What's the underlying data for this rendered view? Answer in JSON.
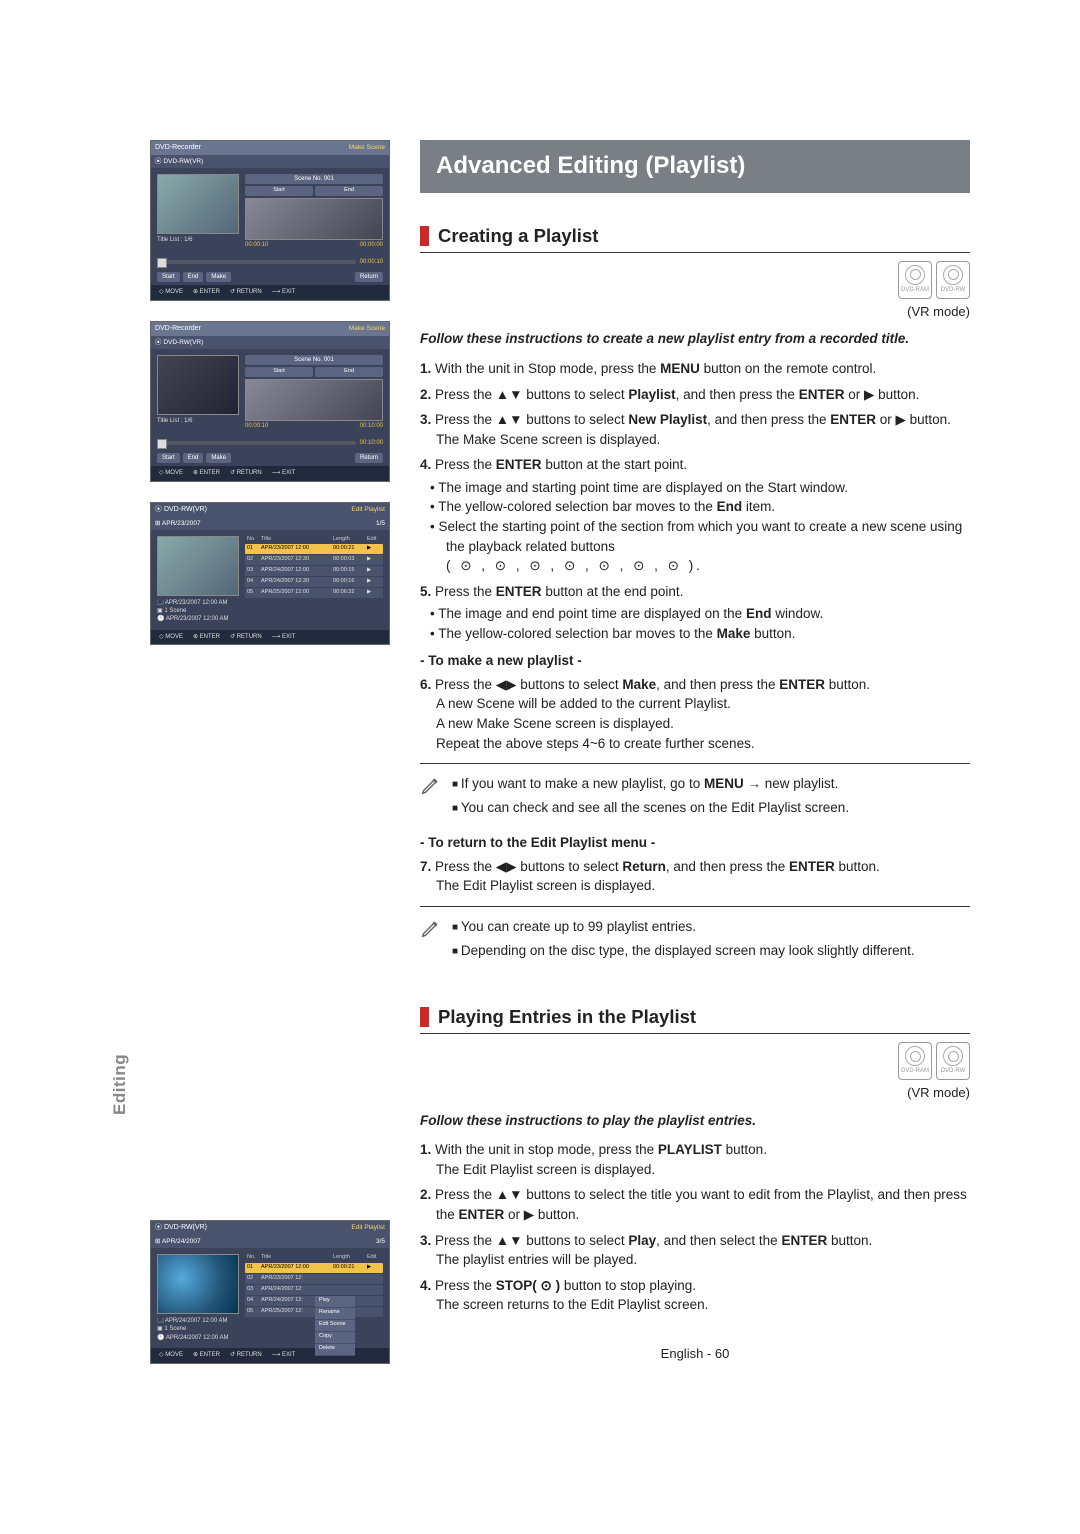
{
  "vlabel": "Editing",
  "banner": "Advanced Editing (Playlist)",
  "pagenum": "English - 60",
  "mini1": {
    "title": "DVD-Recorder",
    "mode": "Make Scene",
    "sub": "DVD-RW(VR)",
    "thumbTitle": "Title List : 1/6",
    "sceneHead": "Scene No. 001",
    "btnStart": "Start",
    "btnEnd": "End",
    "t1": "00:00:10",
    "t2": "00:00:00",
    "ptime": "00:00:10",
    "c1": "Start",
    "c2": "End",
    "c3": "Make",
    "c4": "Return",
    "f1": "MOVE",
    "f2": "ENTER",
    "f3": "RETURN",
    "f4": "EXIT"
  },
  "mini2": {
    "title": "DVD-Recorder",
    "mode": "Make Scene",
    "sub": "DVD-RW(VR)",
    "thumbTitle": "Title List : 1/6",
    "sceneHead": "Scene No. 001",
    "btnStart": "Start",
    "btnEnd": "End",
    "t1": "00:00:10",
    "t2": "00:10:00",
    "ptime": "00:10:00",
    "c1": "Start",
    "c2": "End",
    "c3": "Make",
    "c4": "Return",
    "f1": "MOVE",
    "f2": "ENTER",
    "f3": "RETURN",
    "f4": "EXIT"
  },
  "mini3": {
    "sub": "DVD-RW(VR)",
    "mode": "Edit Playlist",
    "date": "APR/23/2007",
    "pager": "1/5",
    "hNo": "No.",
    "hTitle": "Title",
    "hLen": "Length",
    "hEd": "Edit",
    "rows": [
      {
        "no": "01",
        "title": "APR/23/2007 12:00",
        "len": "00:00:21",
        "ed": "▶"
      },
      {
        "no": "02",
        "title": "APR/23/2007 12:30",
        "len": "00:00:03",
        "ed": "▶"
      },
      {
        "no": "03",
        "title": "APR/24/2007 12:00",
        "len": "00:00:15",
        "ed": "▶"
      },
      {
        "no": "04",
        "title": "APR/24/2007 12:30",
        "len": "00:00:16",
        "ed": "▶"
      },
      {
        "no": "05",
        "title": "APR/25/2007 12:00",
        "len": "00:06:32",
        "ed": "▶"
      }
    ],
    "meta1": "APR/23/2007 12:00 AM",
    "meta2": "1 Scene",
    "meta3": "APR/23/2007 12:00 AM",
    "f1": "MOVE",
    "f2": "ENTER",
    "f3": "RETURN",
    "f4": "EXIT"
  },
  "mini4": {
    "sub": "DVD-RW(VR)",
    "mode": "Edit Playlist",
    "date": "APR/24/2007",
    "pager": "3/5",
    "hNo": "No.",
    "hTitle": "Title",
    "hLen": "Length",
    "hEd": "Edit",
    "rows": [
      {
        "no": "01",
        "title": "APR/23/2007 12:00",
        "len": "00:00:21",
        "ed": "▶"
      },
      {
        "no": "02",
        "title": "APR/23/2007 12:",
        "len": "",
        "ed": ""
      },
      {
        "no": "03",
        "title": "APR/24/2007 12:",
        "len": "",
        "ed": ""
      },
      {
        "no": "04",
        "title": "APR/24/2007 12:",
        "len": "",
        "ed": ""
      },
      {
        "no": "05",
        "title": "APR/25/2007 12:",
        "len": "",
        "ed": ""
      }
    ],
    "ctx": [
      "Play",
      "Rename",
      "Edit Scene",
      "Copy",
      "Delete"
    ],
    "meta1": "APR/24/2007 12:00 AM",
    "meta2": "1 Scene",
    "meta3": "APR/24/2007 12:00 AM",
    "f1": "MOVE",
    "f2": "ENTER",
    "f3": "RETURN",
    "f4": "EXIT"
  },
  "sec1": {
    "h": "Creating a Playlist",
    "discs": [
      "DVD-RAM",
      "DVD-RW"
    ],
    "vrmode": "(VR mode)",
    "lead": "Follow these instructions to create a new playlist entry from a recorded title.",
    "s1a": "1.",
    "s1b": " With the unit in Stop mode, press the ",
    "s1c": "MENU",
    "s1d": " button on the remote control.",
    "s2a": "2.",
    "s2b": " Press the ▲▼ buttons to select ",
    "s2c": "Playlist",
    "s2d": ", and then press the ",
    "s2e": "ENTER",
    "s2f": " or ▶ button.",
    "s3a": "3.",
    "s3b": " Press the ▲▼ buttons to select ",
    "s3c": "New Playlist",
    "s3d": ", and then press the ",
    "s3e": "ENTER",
    "s3f": " or ▶ button.",
    "s3g": "The Make Scene screen is displayed.",
    "s4a": "4.",
    "s4b": " Press the ",
    "s4c": "ENTER",
    "s4d": " button at the start point.",
    "s4bul1": "The image and starting point time are displayed on the Start window.",
    "s4bul2": "The yellow-colored selection bar moves to the ",
    "s4bul2b": "End",
    "s4bul2c": " item.",
    "s4bul3": "Select the starting point of the section from which you want to create a new scene using the playback related buttons",
    "s4icons": "( ⊙ , ⊙ , ⊙ , ⊙ , ⊙ , ⊙ , ⊙ ).",
    "s5a": "5.",
    "s5b": " Press the ",
    "s5c": "ENTER",
    "s5d": " button at the end point.",
    "s5bul1": "The image and end point time are displayed on the ",
    "s5bul1b": "End",
    "s5bul1c": " window.",
    "s5bul2": "The yellow-colored selection bar moves to the ",
    "s5bul2b": "Make",
    "s5bul2c": " button.",
    "sub1": "- To make a new playlist -",
    "s6a": "6.",
    "s6b": " Press the ◀▶ buttons to select ",
    "s6c": "Make",
    "s6d": ", and then press the ",
    "s6e": "ENTER",
    "s6f": " button.",
    "s6g": "A new Scene will be added to the current Playlist.",
    "s6h": "A new Make Scene screen is displayed.",
    "s6i": "Repeat the above steps 4~6 to create further scenes.",
    "note1a": "If you want to make a new playlist, go to ",
    "note1b": "MENU",
    "note1c": " → new playlist.",
    "note1d": "You can check and see all the scenes on the Edit Playlist screen.",
    "sub2": "- To return to the Edit Playlist menu -",
    "s7a": "7.",
    "s7b": " Press the ◀▶ buttons to select ",
    "s7c": "Return",
    "s7d": ", and then press the ",
    "s7e": "ENTER",
    "s7f": " button.",
    "s7g": "The Edit Playlist screen is displayed.",
    "note2a": "You can create up to 99 playlist entries.",
    "note2b": "Depending on the disc type, the displayed screen may look slightly different."
  },
  "sec2": {
    "h": "Playing Entries in the Playlist",
    "discs": [
      "DVD-RAM",
      "DVD-RW"
    ],
    "vrmode": "(VR mode)",
    "lead": "Follow these instructions to play the playlist entries.",
    "s1a": "1.",
    "s1b": " With the unit in stop mode, press the ",
    "s1c": "PLAYLIST",
    "s1d": " button.",
    "s1e": "The Edit Playlist screen is displayed.",
    "s2a": "2.",
    "s2b": " Press the ▲▼ buttons to select the title you want to edit from the Playlist, and then press the ",
    "s2c": "ENTER",
    "s2d": " or ▶ button.",
    "s3a": "3.",
    "s3b": " Press the ▲▼ buttons to select ",
    "s3c": "Play",
    "s3d": ", and then select the ",
    "s3e": "ENTER",
    "s3f": " button.",
    "s3g": "The playlist entries will be played.",
    "s4a": "4.",
    "s4b": " Press the ",
    "s4c": "STOP( ⊙ )",
    "s4d": " button to stop playing.",
    "s4e": "The screen returns to the Edit Playlist screen."
  }
}
